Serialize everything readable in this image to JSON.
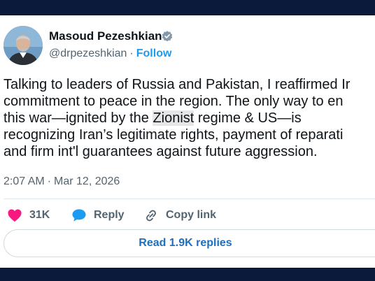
{
  "author": {
    "name": "Masoud Pezeshkian",
    "handle": "@drpezeshkian",
    "separator": "·",
    "follow_label": "Follow"
  },
  "tweet": {
    "lines": [
      "Talking to leaders of Russia and Pakistan, I reaffirmed Ir",
      "commitment to peace in the region. The only way to en",
      "this war—ignited by the ",
      "recognizing Iran’s legitimate rights, payment of reparati",
      "and firm int'l guarantees against future aggression."
    ],
    "line3_highlight": "Zionist",
    "line3_rest": " regime & US—is"
  },
  "meta": {
    "time": "2:07 AM",
    "separator": "·",
    "date": "Mar 12, 2026"
  },
  "actions": {
    "likes": "31K",
    "reply_label": "Reply",
    "copy_label": "Copy link"
  },
  "replies_button": "Read 1.9K replies",
  "colors": {
    "like": "#f91880",
    "reply": "#1d9bf0",
    "link": "#1d9bf0",
    "text": "#0f1419",
    "muted": "#536471",
    "band": "#0b1a3a"
  },
  "icons": [
    "verified-badge-icon",
    "heart-icon",
    "reply-bubble-icon",
    "link-icon"
  ]
}
